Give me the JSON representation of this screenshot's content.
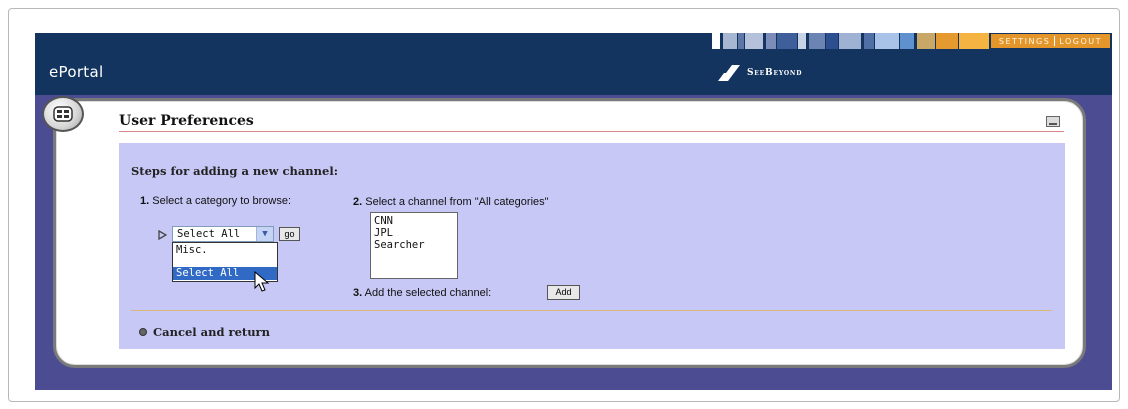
{
  "header": {
    "app_title": "ePortal",
    "brand_name": "SeeBeyond",
    "nav_links": [
      "SETTINGS",
      "LOGOUT"
    ],
    "stripe_colors": [
      "#ffffff",
      "#a7b6d1",
      "#5d76a7",
      "#b5c1db",
      "#7b8db8",
      "#3f5f9a",
      "#c9d3e6",
      "#6c84b4",
      "#2c4f8f",
      "#9fb2d4",
      "#4f6fa5",
      "#a9c3e8",
      "#5f91cf",
      "#c9a767",
      "#e49a2e",
      "#f5b342"
    ]
  },
  "panel": {
    "title": "User Preferences",
    "steps_heading": "Steps for adding a new channel:",
    "step1": {
      "num": "1.",
      "label": "Select a category to browse:",
      "selected": "Select All",
      "options": [
        "Misc.",
        "Select All"
      ],
      "go_label": "go"
    },
    "step2": {
      "num": "2.",
      "label": "Select a channel from \"All categories\"",
      "channels": [
        "CNN",
        "JPL",
        "Searcher"
      ]
    },
    "step3": {
      "num": "3.",
      "label": "Add the selected channel:",
      "add_label": "Add"
    },
    "cancel_label": "Cancel and return"
  },
  "icons": [
    "menu-icon",
    "minimize-icon",
    "play-icon",
    "chevron-down-icon",
    "cursor-icon",
    "bullet-icon",
    "seebeyond-logo-icon"
  ]
}
